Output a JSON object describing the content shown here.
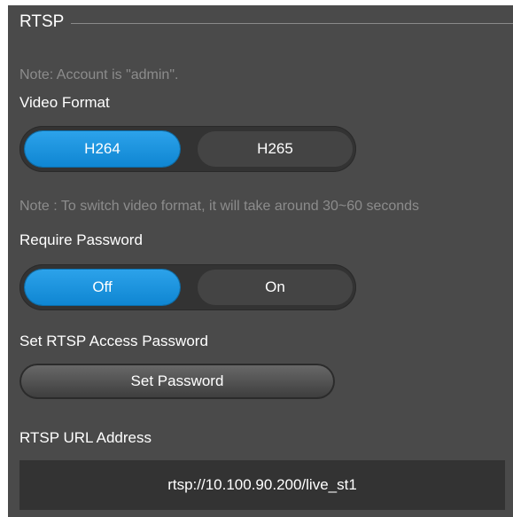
{
  "section": {
    "title": "RTSP"
  },
  "account_note": "Note: Account is \"admin\".",
  "video_format": {
    "label": "Video Format",
    "options": [
      "H264",
      "H265"
    ],
    "selected": "H264"
  },
  "switch_note": "Note : To switch video format, it will take around 30~60 seconds",
  "require_password": {
    "label": "Require Password",
    "options": [
      "Off",
      "On"
    ],
    "selected": "Off"
  },
  "access_password": {
    "label": "Set RTSP Access Password",
    "button": "Set Password"
  },
  "url": {
    "label": "RTSP URL Address",
    "value": "rtsp://10.100.90.200/live_st1"
  },
  "colors": {
    "accent": "#1a93dd",
    "panel_bg": "#4a4a4a",
    "note_text": "#8c8c8c"
  }
}
